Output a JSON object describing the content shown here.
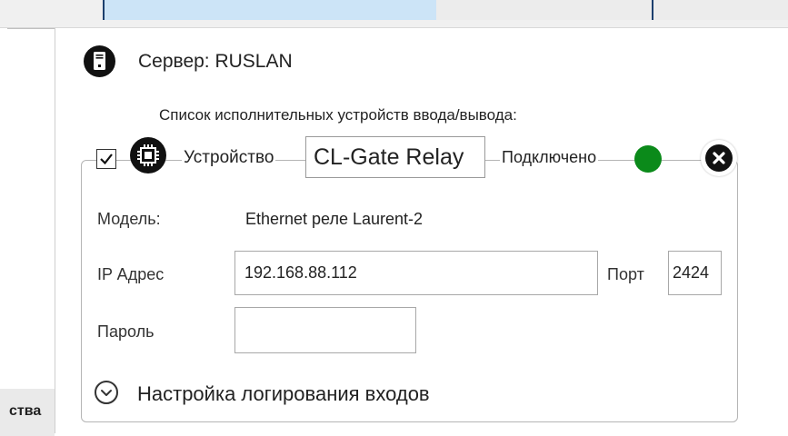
{
  "tabs": [
    {
      "label": ""
    },
    {
      "label": ""
    },
    {
      "label": ""
    }
  ],
  "sidebar": {
    "items": [
      {
        "label": "ства"
      }
    ]
  },
  "server": {
    "title": "Сервер: RUSLAN",
    "icon": "server-icon"
  },
  "device_list_caption": "Список исполнительных устройств ввода/вывода:",
  "device": {
    "enabled": true,
    "icon": "chip-icon",
    "label": "Устройство",
    "name": "CL-Gate Relay",
    "status": "Подключено",
    "status_color": "#0b8a1a",
    "close_icon": "close-icon",
    "fields": {
      "model_label": "Модель:",
      "model_value": "Ethernet реле Laurent-2",
      "ip_label": "IP Адрес",
      "ip_value": "192.168.88.112",
      "port_label": "Порт",
      "port_value": "2424",
      "password_label": "Пароль",
      "password_value": ""
    },
    "expander": {
      "icon": "chevron-down-circle-icon",
      "label": "Настройка логирования входов"
    }
  }
}
